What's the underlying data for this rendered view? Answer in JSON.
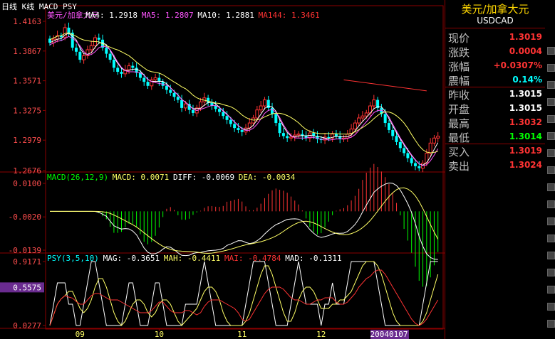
{
  "chart_data": [
    {
      "type": "candlestick",
      "title": "美元/加拿大元",
      "chart_label": "日线 K线 MACD PSY",
      "yticks": [
        "1.4163",
        "1.3867",
        "1.3571",
        "1.3275",
        "1.2979",
        "1.2676"
      ],
      "ylim": [
        1.2676,
        1.4163
      ],
      "legend": [
        {
          "text": "美元/加拿大元",
          "color": "#ff55ff"
        },
        {
          "text": "MA4: 1.2918",
          "color": "#ffffff"
        },
        {
          "text": "MA5: 1.2807",
          "color": "#ff55ff"
        },
        {
          "text": "MA10: 1.2881",
          "color": "#ffffff"
        },
        {
          "text": "MA144: 1.3461",
          "color": "#ff3333"
        }
      ],
      "ma144": {
        "x_start": 78,
        "y_start": 1.358,
        "x_end": 100,
        "y_end": 1.347
      },
      "closes": [
        1.395,
        1.3985,
        1.402,
        1.4005,
        1.41,
        1.405,
        1.39,
        1.386,
        1.378,
        1.382,
        1.388,
        1.392,
        1.4,
        1.398,
        1.39,
        1.384,
        1.378,
        1.37,
        1.366,
        1.364,
        1.368,
        1.372,
        1.37,
        1.365,
        1.36,
        1.356,
        1.352,
        1.358,
        1.36,
        1.356,
        1.352,
        1.348,
        1.345,
        1.341,
        1.338,
        1.33,
        1.334,
        1.328,
        1.325,
        1.33,
        1.336,
        1.34,
        1.335,
        1.332,
        1.329,
        1.326,
        1.322,
        1.318,
        1.314,
        1.31,
        1.308,
        1.306,
        1.31,
        1.315,
        1.32,
        1.328,
        1.332,
        1.338,
        1.33,
        1.324,
        1.315,
        1.305,
        1.302,
        1.3,
        1.301,
        1.303,
        1.304,
        1.302,
        1.3,
        1.305,
        1.302,
        1.299,
        1.298,
        1.301,
        1.3,
        1.304,
        1.302,
        1.299,
        1.3,
        1.304,
        1.309,
        1.315,
        1.32,
        1.322,
        1.325,
        1.332,
        1.338,
        1.33,
        1.324,
        1.315,
        1.308,
        1.302,
        1.296,
        1.29,
        1.285,
        1.28,
        1.275,
        1.272,
        1.27,
        1.275,
        1.285,
        1.295,
        1.3,
        1.3019
      ],
      "xticks": [
        {
          "label": "09",
          "i": 8
        },
        {
          "label": "10",
          "i": 29
        },
        {
          "label": "11",
          "i": 51
        },
        {
          "label": "12",
          "i": 72
        },
        {
          "label": "20040107",
          "i": 90
        }
      ],
      "current_date": "20040107"
    },
    {
      "type": "bar+line",
      "title": "MACD(26,12,9)",
      "yticks": [
        "0.0100",
        "-0.0020",
        "-0.0139"
      ],
      "ylim": [
        -0.0139,
        0.01
      ],
      "legend": [
        {
          "text": "MACD(26,12,9)",
          "color": "#00ff00"
        },
        {
          "text": "MACD: 0.0071",
          "color": "#ffff66"
        },
        {
          "text": "DIFF: -0.0069",
          "color": "#ffffff"
        },
        {
          "text": "DEA: -0.0034",
          "color": "#ffff66"
        }
      ]
    },
    {
      "type": "line",
      "title": "PSY(3,5,10)",
      "yticks": [
        "0.9171",
        "0.5575",
        "0.0277"
      ],
      "highlighted_tick": "0.5575",
      "ylim": [
        0.0277,
        0.9171
      ],
      "legend": [
        {
          "text": "PSY(3,5,10)",
          "color": "#00ffff"
        },
        {
          "text": "MAG: -0.3651",
          "color": "#ffffff"
        },
        {
          "text": "MAH: -0.4411",
          "color": "#ffff66"
        },
        {
          "text": "MAI: -0.4784",
          "color": "#ff3333"
        },
        {
          "text": "MAD: -0.1311",
          "color": "#ffffff"
        }
      ]
    }
  ],
  "quote": {
    "title": "美元/加拿大元",
    "code": "USDCAD",
    "rows": [
      {
        "label": "现价",
        "value": "1.3019",
        "color": "#ff3333"
      },
      {
        "label": "涨跌",
        "value": "0.0004",
        "color": "#ff3333"
      },
      {
        "label": "涨幅",
        "value": "+0.0307%",
        "color": "#ff3333"
      },
      {
        "label": "震幅",
        "value": "0.14%",
        "color": "#00ffff"
      },
      {
        "label": "昨收",
        "value": "1.3015",
        "color": "#ffffff"
      },
      {
        "label": "开盘",
        "value": "1.3015",
        "color": "#ffffff"
      },
      {
        "label": "最高",
        "value": "1.3032",
        "color": "#ff3333"
      },
      {
        "label": "最低",
        "value": "1.3014",
        "color": "#00ff00"
      },
      {
        "label": "买入",
        "value": "1.3019",
        "color": "#ff3333"
      },
      {
        "label": "卖出",
        "value": "1.3024",
        "color": "#ff3333"
      }
    ]
  }
}
